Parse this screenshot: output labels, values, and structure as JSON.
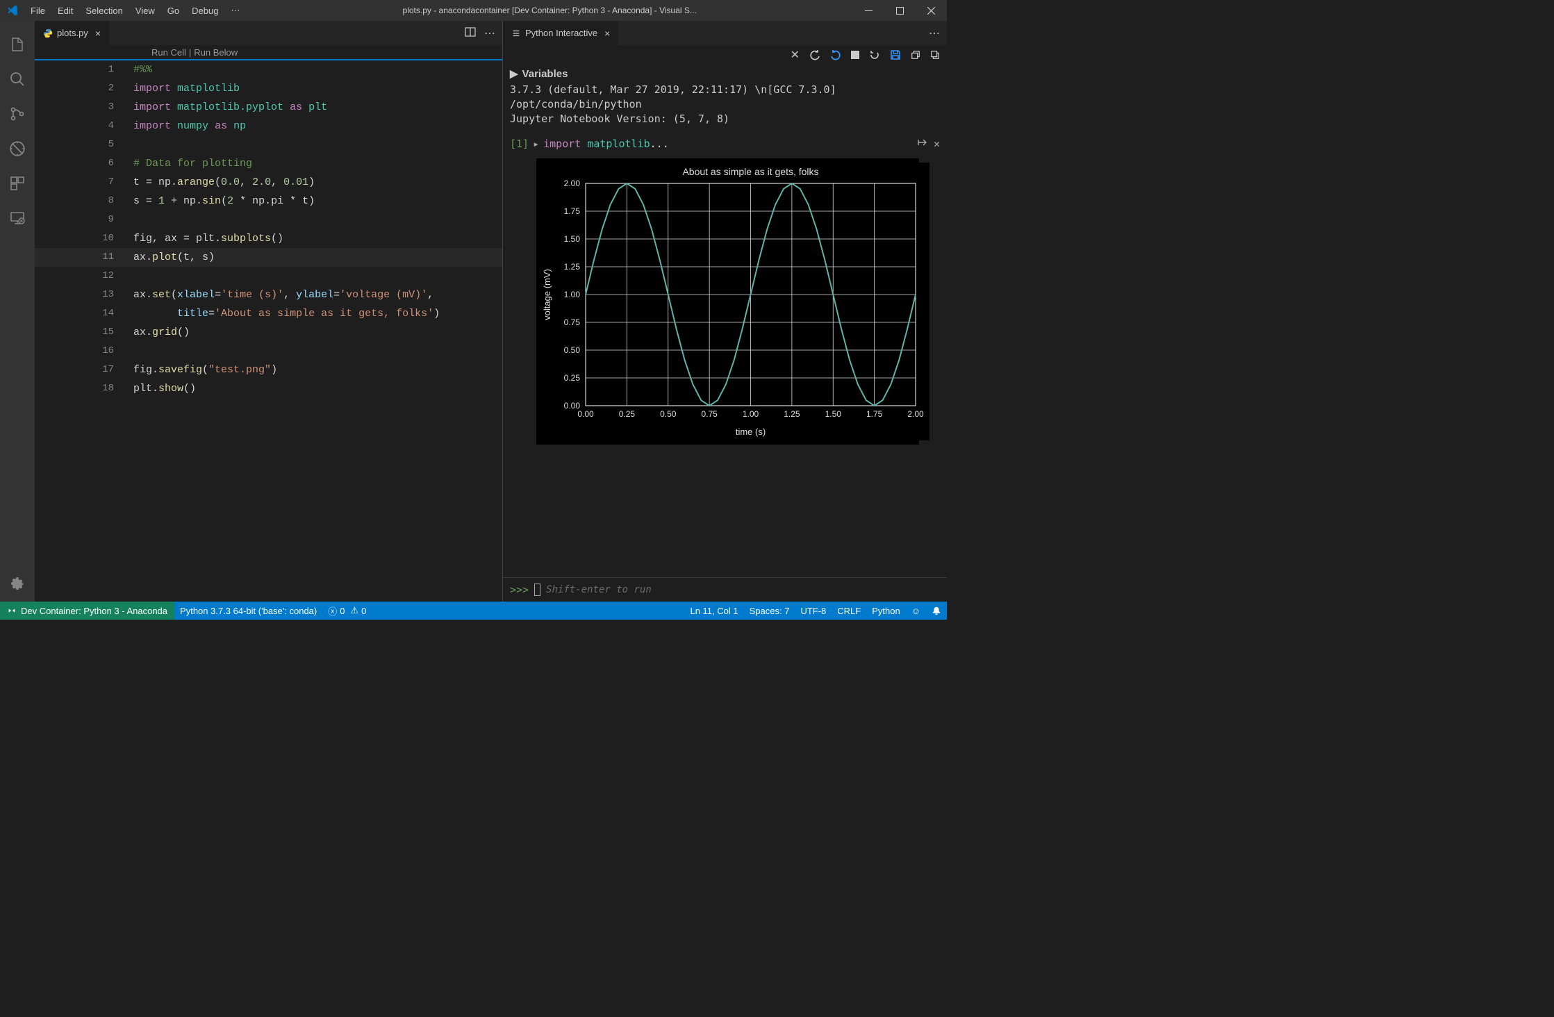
{
  "title": "plots.py - anacondacontainer [Dev Container: Python 3 - Anaconda] - Visual S...",
  "menu": [
    "File",
    "Edit",
    "Selection",
    "View",
    "Go",
    "Debug"
  ],
  "tab": {
    "name": "plots.py"
  },
  "interactive_tab": "Python Interactive",
  "codelens": {
    "run_cell": "Run Cell",
    "sep": " | ",
    "run_below": "Run Below"
  },
  "code": [
    {
      "n": "1",
      "tokens": [
        [
          "#%%",
          "comment"
        ]
      ]
    },
    {
      "n": "2",
      "tokens": [
        [
          "import",
          "keyword"
        ],
        [
          " ",
          ""
        ],
        [
          "matplotlib",
          "module"
        ]
      ]
    },
    {
      "n": "3",
      "tokens": [
        [
          "import",
          "keyword"
        ],
        [
          " ",
          ""
        ],
        [
          "matplotlib.pyplot",
          "module"
        ],
        [
          " ",
          ""
        ],
        [
          "as",
          "keyword"
        ],
        [
          " ",
          ""
        ],
        [
          "plt",
          "module"
        ]
      ]
    },
    {
      "n": "4",
      "tokens": [
        [
          "import",
          "keyword"
        ],
        [
          " ",
          ""
        ],
        [
          "numpy",
          "module"
        ],
        [
          " ",
          ""
        ],
        [
          "as",
          "keyword"
        ],
        [
          " ",
          ""
        ],
        [
          "np",
          "module"
        ]
      ]
    },
    {
      "n": "5",
      "tokens": []
    },
    {
      "n": "6",
      "tokens": [
        [
          "# Data for plotting",
          "comment"
        ]
      ]
    },
    {
      "n": "7",
      "tokens": [
        [
          "t = np.",
          "plain"
        ],
        [
          "arange",
          "func"
        ],
        [
          "(",
          "plain"
        ],
        [
          "0.0",
          "num"
        ],
        [
          ", ",
          "plain"
        ],
        [
          "2.0",
          "num"
        ],
        [
          ", ",
          "plain"
        ],
        [
          "0.01",
          "num"
        ],
        [
          ")",
          "plain"
        ]
      ]
    },
    {
      "n": "8",
      "tokens": [
        [
          "s = ",
          "plain"
        ],
        [
          "1",
          "num"
        ],
        [
          " + np.",
          "plain"
        ],
        [
          "sin",
          "func"
        ],
        [
          "(",
          "plain"
        ],
        [
          "2",
          "num"
        ],
        [
          " * np.pi * t)",
          "plain"
        ]
      ]
    },
    {
      "n": "9",
      "tokens": []
    },
    {
      "n": "10",
      "tokens": [
        [
          "fig, ax = plt.",
          "plain"
        ],
        [
          "subplots",
          "func"
        ],
        [
          "()",
          "plain"
        ]
      ]
    },
    {
      "n": "11",
      "tokens": [
        [
          "ax.",
          "plain"
        ],
        [
          "plot",
          "func"
        ],
        [
          "(t, s)",
          "plain"
        ]
      ],
      "active": true
    },
    {
      "n": "12",
      "tokens": []
    },
    {
      "n": "13",
      "tokens": [
        [
          "ax.",
          "plain"
        ],
        [
          "set",
          "func"
        ],
        [
          "(",
          "plain"
        ],
        [
          "xlabel",
          "var"
        ],
        [
          "=",
          "plain"
        ],
        [
          "'time (s)'",
          "str"
        ],
        [
          ", ",
          "plain"
        ],
        [
          "ylabel",
          "var"
        ],
        [
          "=",
          "plain"
        ],
        [
          "'voltage (mV)'",
          "str"
        ],
        [
          ",",
          "plain"
        ]
      ]
    },
    {
      "n": "14",
      "tokens": [
        [
          "       ",
          "plain"
        ],
        [
          "title",
          "var"
        ],
        [
          "=",
          "plain"
        ],
        [
          "'About as simple as it gets, folks'",
          "str"
        ],
        [
          ")",
          "plain"
        ]
      ]
    },
    {
      "n": "15",
      "tokens": [
        [
          "ax.",
          "plain"
        ],
        [
          "grid",
          "func"
        ],
        [
          "()",
          "plain"
        ]
      ]
    },
    {
      "n": "16",
      "tokens": []
    },
    {
      "n": "17",
      "tokens": [
        [
          "fig.",
          "plain"
        ],
        [
          "savefig",
          "func"
        ],
        [
          "(",
          "plain"
        ],
        [
          "\"test.png\"",
          "str"
        ],
        [
          ")",
          "plain"
        ]
      ]
    },
    {
      "n": "18",
      "tokens": [
        [
          "plt.",
          "plain"
        ],
        [
          "show",
          "func"
        ],
        [
          "()",
          "plain"
        ]
      ]
    }
  ],
  "variables_label": "Variables",
  "kernel_lines": [
    "3.7.3 (default, Mar 27 2019, 22:11:17) \\n[GCC 7.3.0]",
    "/opt/conda/bin/python",
    "Jupyter Notebook Version: (5, 7, 8)"
  ],
  "cell": {
    "num": "[1]",
    "code_prefix": "import ",
    "code_mod": "matplotlib",
    "code_suffix": "..."
  },
  "input": {
    "prompt": ">>>",
    "placeholder": "Shift-enter to run"
  },
  "statusbar": {
    "remote": "Dev Container: Python 3 - Anaconda",
    "python": "Python 3.7.3 64-bit ('base': conda)",
    "errors": "0",
    "warnings": "0",
    "ln_col": "Ln 11, Col 1",
    "spaces": "Spaces: 7",
    "encoding": "UTF-8",
    "eol": "CRLF",
    "lang": "Python"
  },
  "chart_data": {
    "type": "line",
    "title": "About as simple as it gets, folks",
    "xlabel": "time (s)",
    "ylabel": "voltage (mV)",
    "xlim": [
      0.0,
      2.0
    ],
    "ylim": [
      0.0,
      2.0
    ],
    "xticks": [
      0.0,
      0.25,
      0.5,
      0.75,
      1.0,
      1.25,
      1.5,
      1.75,
      2.0
    ],
    "yticks": [
      0.0,
      0.25,
      0.5,
      0.75,
      1.0,
      1.25,
      1.5,
      1.75,
      2.0
    ],
    "grid": true,
    "line_color": "#5fb3a8",
    "function": "s = 1 + sin(2*pi*t)",
    "x": [
      0.0,
      0.05,
      0.1,
      0.15,
      0.2,
      0.25,
      0.3,
      0.35,
      0.4,
      0.45,
      0.5,
      0.55,
      0.6,
      0.65,
      0.7,
      0.75,
      0.8,
      0.85,
      0.9,
      0.95,
      1.0,
      1.05,
      1.1,
      1.15,
      1.2,
      1.25,
      1.3,
      1.35,
      1.4,
      1.45,
      1.5,
      1.55,
      1.6,
      1.65,
      1.7,
      1.75,
      1.8,
      1.85,
      1.9,
      1.95,
      2.0
    ],
    "y": [
      1.0,
      1.309,
      1.588,
      1.809,
      1.951,
      2.0,
      1.951,
      1.809,
      1.588,
      1.309,
      1.0,
      0.691,
      0.412,
      0.191,
      0.049,
      0.0,
      0.049,
      0.191,
      0.412,
      0.691,
      1.0,
      1.309,
      1.588,
      1.809,
      1.951,
      2.0,
      1.951,
      1.809,
      1.588,
      1.309,
      1.0,
      0.691,
      0.412,
      0.191,
      0.049,
      0.0,
      0.049,
      0.191,
      0.412,
      0.691,
      1.0
    ]
  }
}
